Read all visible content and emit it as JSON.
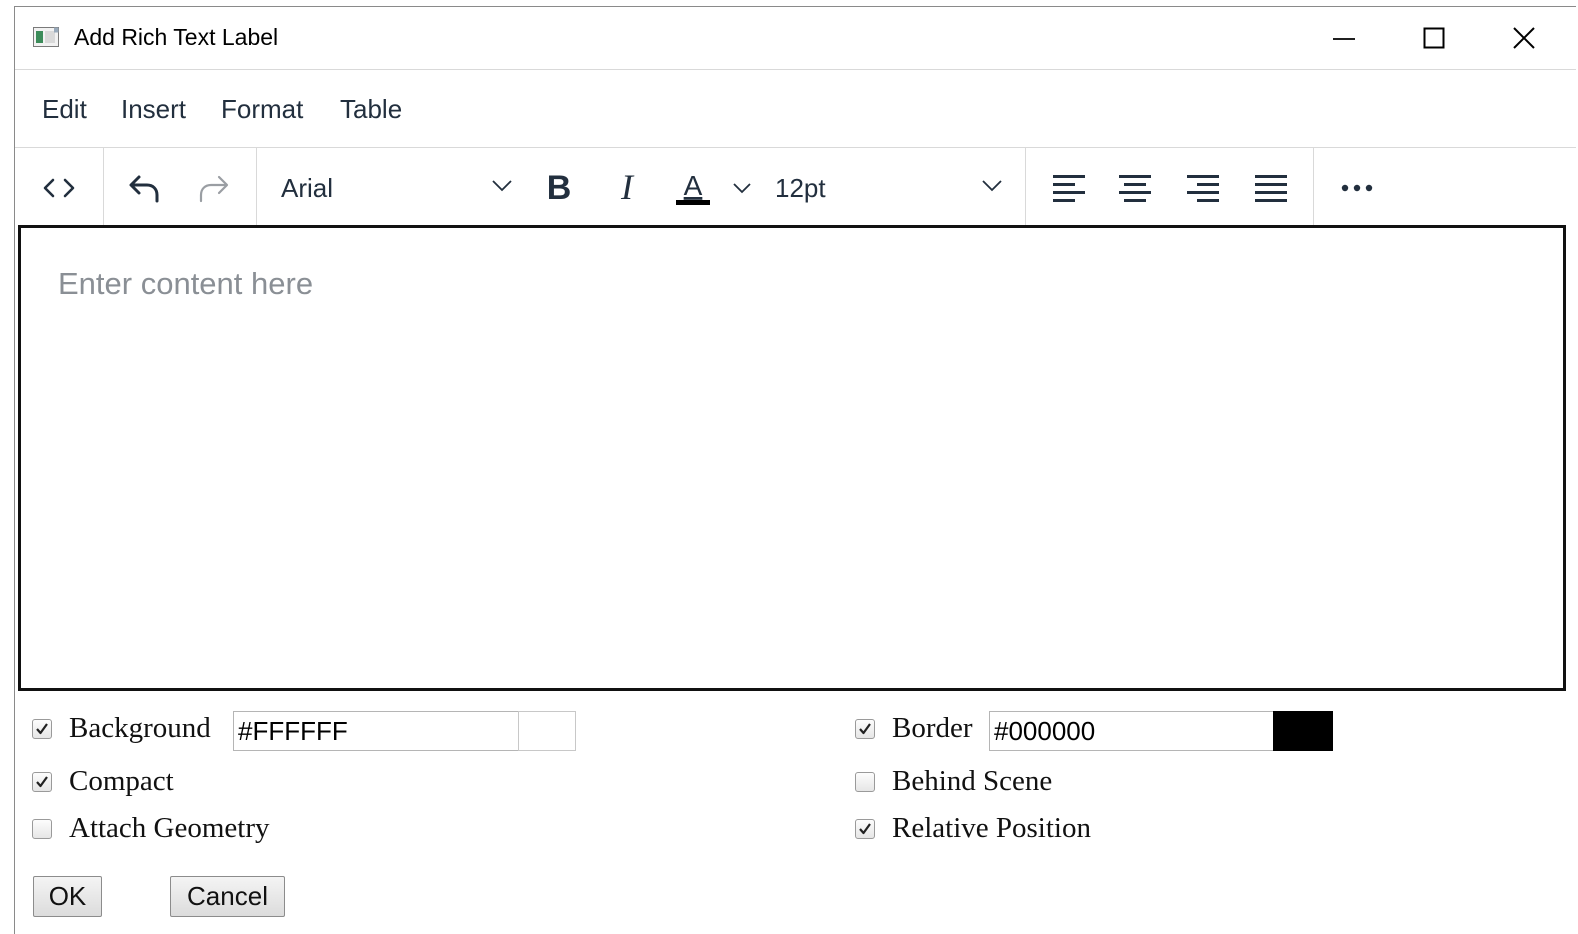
{
  "window": {
    "title": "Add Rich Text Label"
  },
  "menu": [
    "Edit",
    "Insert",
    "Format",
    "Table"
  ],
  "toolbar": {
    "font_family": "Arial",
    "font_size": "12pt",
    "text_color": "#000000"
  },
  "editor": {
    "placeholder": "Enter content here",
    "content": ""
  },
  "options": {
    "background": {
      "label": "Background",
      "checked": true,
      "value": "#FFFFFF",
      "swatch": "#FFFFFF"
    },
    "border": {
      "label": "Border",
      "checked": true,
      "value": "#000000",
      "swatch": "#000000"
    },
    "compact": {
      "label": "Compact",
      "checked": true
    },
    "behind_scene": {
      "label": "Behind Scene",
      "checked": false
    },
    "attach_geometry": {
      "label": "Attach Geometry",
      "checked": false
    },
    "relative_position": {
      "label": "Relative Position",
      "checked": true
    }
  },
  "buttons": {
    "ok": "OK",
    "cancel": "Cancel"
  }
}
